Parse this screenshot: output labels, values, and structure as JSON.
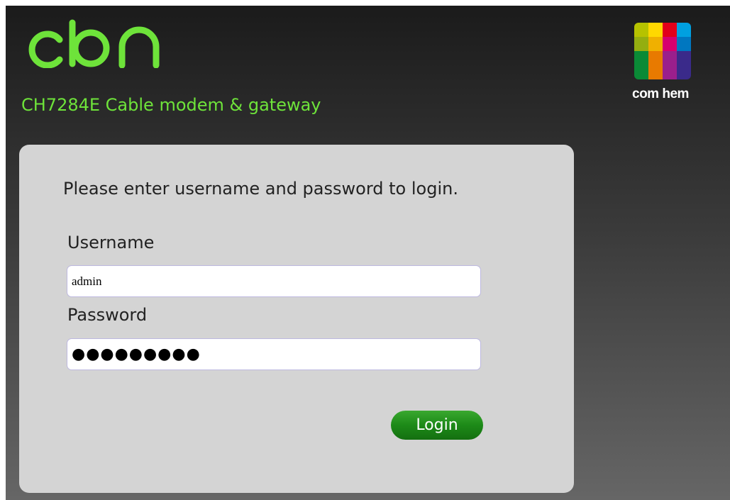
{
  "header": {
    "brand_logo": "cbn",
    "brand_color": "#6ee33a",
    "subtitle": "CH7284E Cable modem & gateway"
  },
  "operator": {
    "name": "com hem",
    "grid_colors": [
      "#b6c200",
      "#ffd800",
      "#e2001a",
      "#00a0e0",
      "#94ae10",
      "#f0b000",
      "#d6006e",
      "#0077c0",
      "#0a8a36",
      "#e87a00",
      "#9a1f8c",
      "#3a2a8a",
      "#0a8a36",
      "#e87a00",
      "#9a1f8c",
      "#3a2a8a"
    ]
  },
  "login": {
    "prompt": "Please enter username and password to login.",
    "username_label": "Username",
    "username_value": "admin",
    "password_label": "Password",
    "password_value": "●●●●●●●●●",
    "login_button": "Login"
  }
}
